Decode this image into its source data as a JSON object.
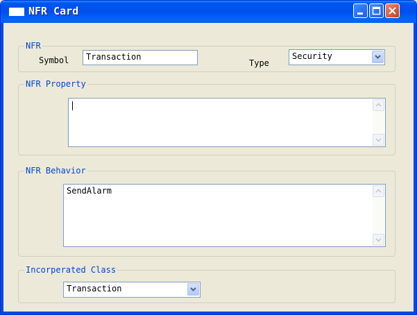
{
  "window": {
    "title": "NFR Card"
  },
  "nfr": {
    "group_label": "NFR",
    "symbol_label": "Symbol",
    "symbol_value": "Transaction",
    "type_label": "Type",
    "type_value": "Security"
  },
  "property": {
    "group_label": "NFR Property",
    "text": ""
  },
  "behavior": {
    "group_label": "NFR Behavior",
    "text": "SendAlarm"
  },
  "incorporated": {
    "group_label": "Incorperated Class",
    "value": "Transaction"
  },
  "colors": {
    "title_bar": "#0053ee",
    "group_label": "#0046d5",
    "background": "#ece9d8",
    "close_button": "#d64b2a"
  },
  "icons": [
    "app-icon",
    "minimize-icon",
    "maximize-icon",
    "close-icon",
    "chevron-down-icon",
    "scroll-up-icon",
    "scroll-down-icon"
  ]
}
